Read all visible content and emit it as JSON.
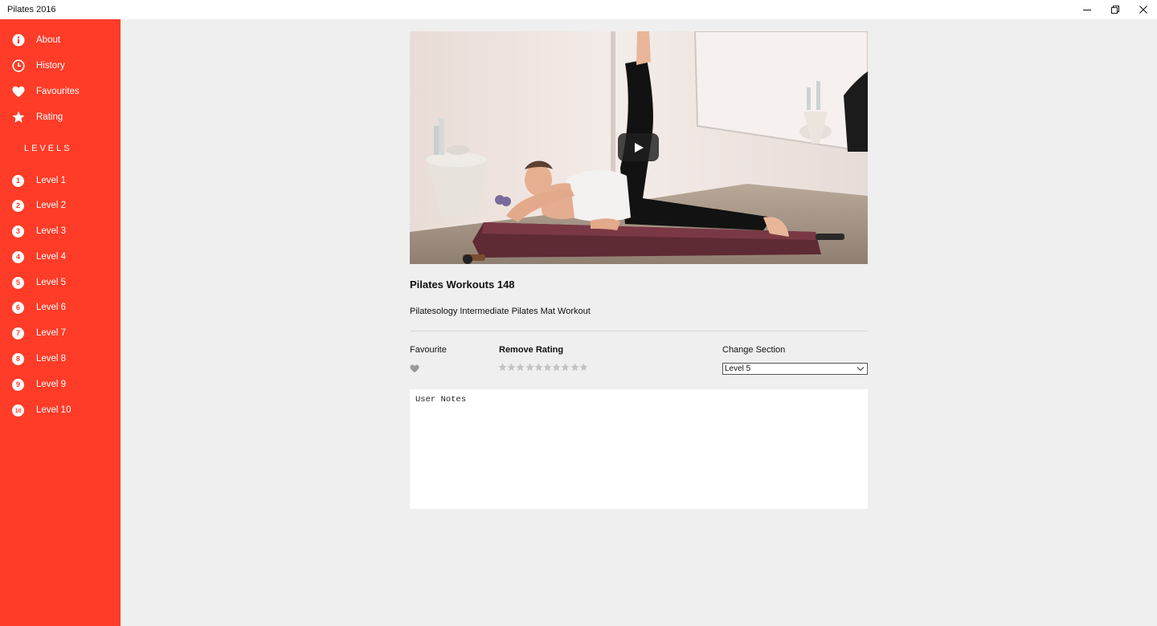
{
  "window": {
    "title": "Pilates 2016",
    "controls": {
      "minimize_icon": "minimize-icon",
      "restore_icon": "restore-icon",
      "close_icon": "close-icon"
    }
  },
  "sidebar": {
    "background": "#ff3c28",
    "menu": [
      {
        "label": "About",
        "icon": "info-icon"
      },
      {
        "label": "History",
        "icon": "clock-icon"
      },
      {
        "label": "Favourites",
        "icon": "heart-icon"
      },
      {
        "label": "Rating",
        "icon": "star-icon"
      }
    ],
    "levels_heading": "LEVELS",
    "levels": [
      {
        "num": "1",
        "label": "Level 1"
      },
      {
        "num": "2",
        "label": "Level 2"
      },
      {
        "num": "3",
        "label": "Level 3"
      },
      {
        "num": "4",
        "label": "Level 4"
      },
      {
        "num": "5",
        "label": "Level 5"
      },
      {
        "num": "6",
        "label": "Level 6"
      },
      {
        "num": "7",
        "label": "Level 7"
      },
      {
        "num": "8",
        "label": "Level 8"
      },
      {
        "num": "9",
        "label": "Level 9"
      },
      {
        "num": "10",
        "label": "Level 10"
      }
    ]
  },
  "main": {
    "video": {
      "play_icon": "play-icon"
    },
    "title": "Pilates Workouts 148",
    "subtitle": "Pilatesology Intermediate Pilates Mat Workout",
    "favourite": {
      "label": "Favourite",
      "icon": "heart-icon",
      "active": false
    },
    "rating": {
      "label": "Remove Rating",
      "max": 10,
      "value": 0
    },
    "section": {
      "label": "Change Section",
      "selected": "Level 5"
    },
    "notes": {
      "placeholder": "User Notes",
      "value": ""
    }
  }
}
